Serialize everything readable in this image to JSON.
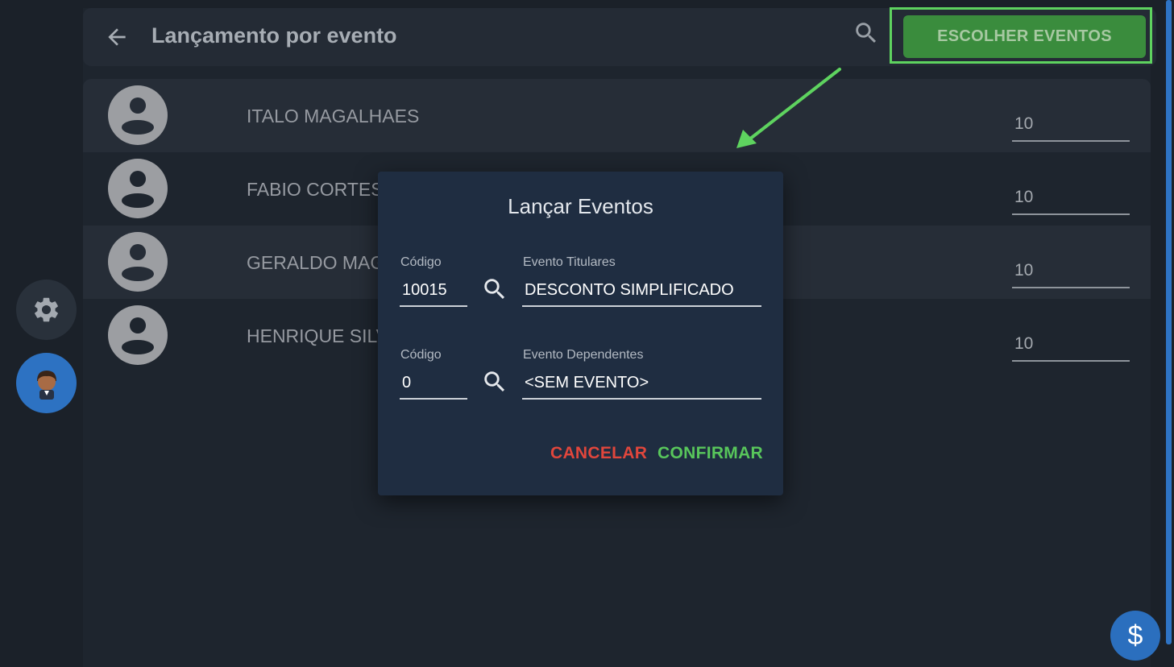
{
  "header": {
    "title": "Lançamento por evento",
    "choose_button": "ESCOLHER EVENTOS"
  },
  "employees": [
    {
      "name": "ITALO MAGALHAES",
      "value": "10"
    },
    {
      "name": "FABIO CORTES",
      "value": "10"
    },
    {
      "name": "GERALDO MAGU",
      "value": "10"
    },
    {
      "name": "HENRIQUE SILVA",
      "value": "10"
    }
  ],
  "dialog": {
    "title": "Lançar Eventos",
    "titulares": {
      "code_label": "Código",
      "code_value": "10015",
      "event_label": "Evento Titulares",
      "event_value": "DESCONTO SIMPLIFICADO"
    },
    "dependentes": {
      "code_label": "Código",
      "code_value": "0",
      "event_label": "Evento Dependentes",
      "event_value": "<SEM EVENTO>"
    },
    "cancel_label": "CANCELAR",
    "confirm_label": "CONFIRMAR"
  },
  "fab": {
    "currency_symbol": "$"
  },
  "colors": {
    "background": "#1b2129",
    "topbar": "#242b35",
    "dialog": "#1f2d41",
    "choose_button": "#3a8c3d",
    "highlight": "#5ed35f",
    "cancel": "#e0463c",
    "confirm": "#58c65b",
    "accent_blue": "#2d72c2"
  },
  "icons": [
    "back-arrow-icon",
    "search-icon",
    "gear-icon",
    "user-avatar-icon",
    "person-icon",
    "dollar-icon"
  ]
}
